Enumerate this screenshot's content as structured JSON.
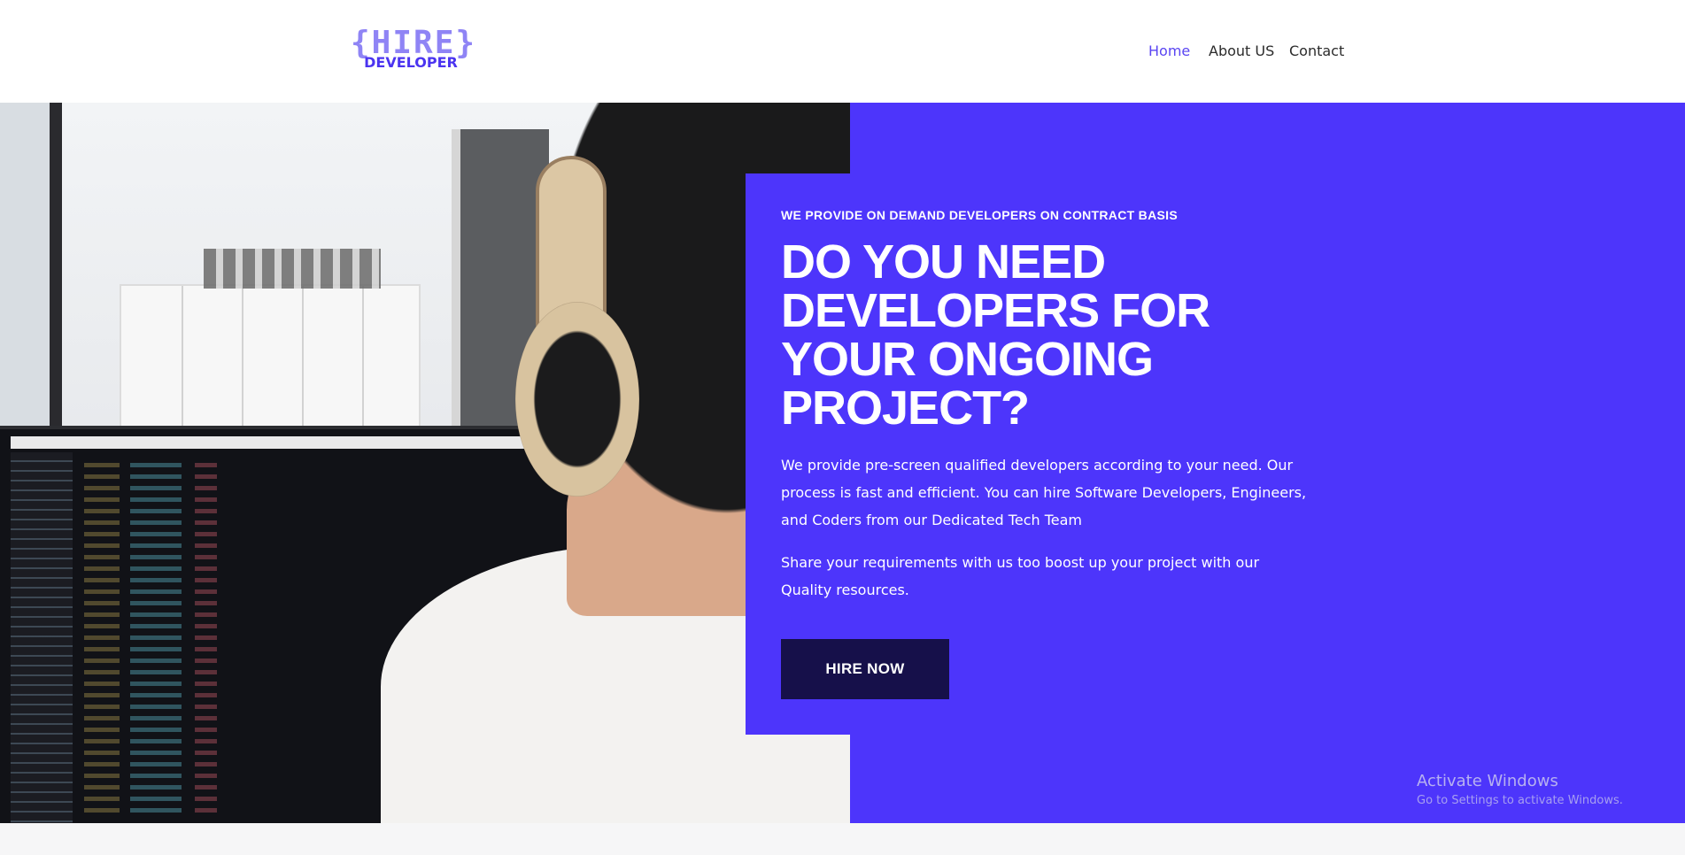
{
  "header": {
    "logo": {
      "line1": "{HIRE}",
      "line2": "DEVELOPER"
    },
    "nav": [
      {
        "label": "Home",
        "active": true
      },
      {
        "label": "About US",
        "active": false
      },
      {
        "label": "Contact",
        "active": false
      }
    ]
  },
  "hero": {
    "eyebrow": "WE PROVIDE ON DEMAND DEVELOPERS ON CONTRACT BASIS",
    "headline": "DO YOU NEED DEVELOPERS FOR YOUR ONGOING PROJECT?",
    "paragraph1": "We provide pre-screen qualified developers according to your need. Our process is fast and efficient. You can hire Software Developers, Engineers, and Coders from our Dedicated Tech Team",
    "paragraph2": "Share your requirements with us too boost up your project with our Quality resources.",
    "cta_label": "HIRE NOW",
    "image_icon": "developer-with-headphones-photo"
  },
  "watermark": {
    "title": "Activate Windows",
    "subtitle": "Go to Settings to activate Windows."
  },
  "colors": {
    "accent": "#4d35fb",
    "button": "#16104a",
    "nav_active": "#5a45f2"
  }
}
